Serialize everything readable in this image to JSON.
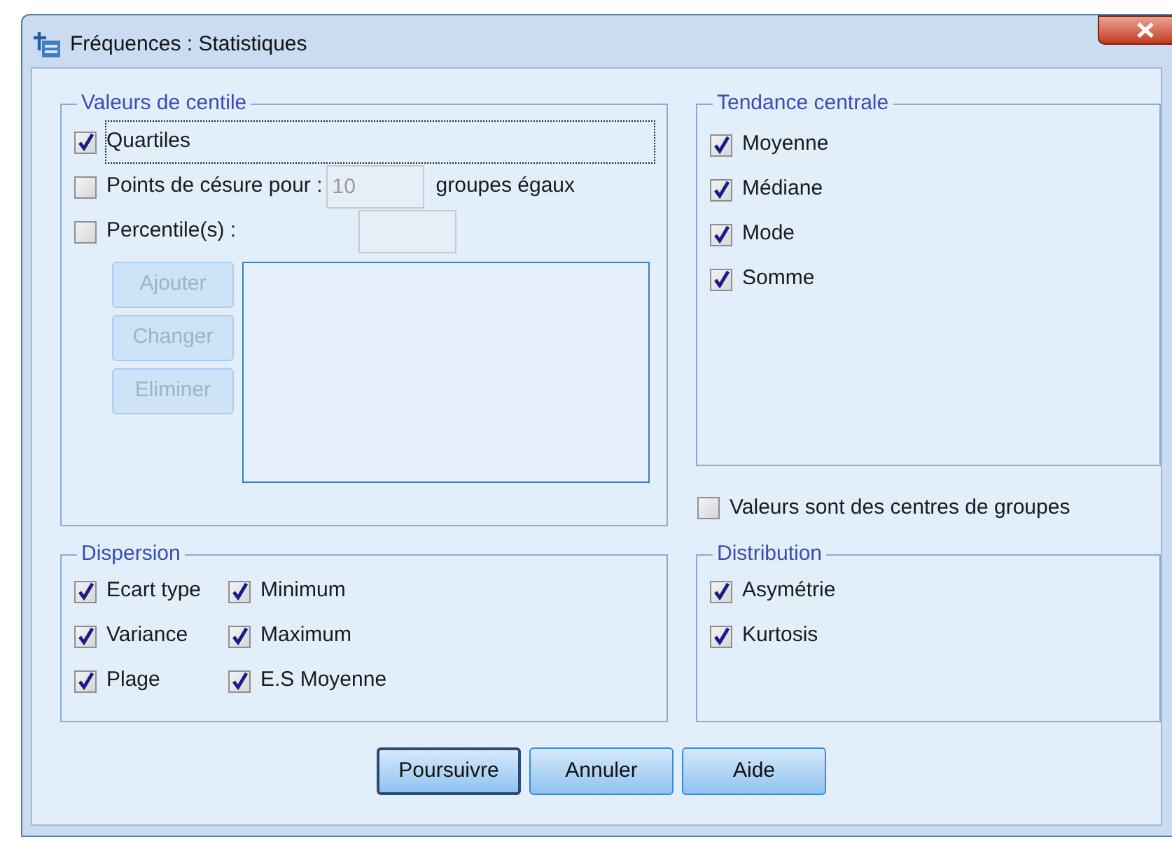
{
  "window": {
    "title": "Fréquences : Statistiques"
  },
  "percentile_values": {
    "title": "Valeurs de centile",
    "quartiles": {
      "label": "Quartiles",
      "checked": true,
      "focused": true
    },
    "cut_points": {
      "label": "Points de césure pour :",
      "checked": false,
      "value": "10",
      "disabled": true,
      "suffix": "groupes égaux"
    },
    "percentiles": {
      "label": "Percentile(s) :",
      "checked": false,
      "disabled": true
    },
    "buttons": [
      {
        "label": "Ajouter",
        "disabled": true
      },
      {
        "label": "Changer",
        "disabled": true
      },
      {
        "label": "Eliminer",
        "disabled": true
      }
    ]
  },
  "central_tendency": {
    "title": "Tendance centrale",
    "items": [
      {
        "label": "Moyenne",
        "checked": true
      },
      {
        "label": "Médiane",
        "checked": true
      },
      {
        "label": "Mode",
        "checked": true
      },
      {
        "label": "Somme",
        "checked": true
      }
    ]
  },
  "grouped_midpoints": {
    "label": "Valeurs sont des centres de groupes",
    "checked": false
  },
  "dispersion": {
    "title": "Dispersion",
    "items": [
      {
        "label": "Ecart type",
        "checked": true
      },
      {
        "label": "Minimum",
        "checked": true
      },
      {
        "label": "Variance",
        "checked": true
      },
      {
        "label": "Maximum",
        "checked": true
      },
      {
        "label": "Plage",
        "checked": true
      },
      {
        "label": "E.S Moyenne",
        "checked": true
      }
    ]
  },
  "distribution": {
    "title": "Distribution",
    "items": [
      {
        "label": "Asymétrie",
        "checked": true
      },
      {
        "label": "Kurtosis",
        "checked": true
      }
    ]
  },
  "buttons": [
    {
      "label": "Poursuivre",
      "default": true
    },
    {
      "label": "Annuler",
      "default": false
    },
    {
      "label": "Aide",
      "default": false
    }
  ]
}
